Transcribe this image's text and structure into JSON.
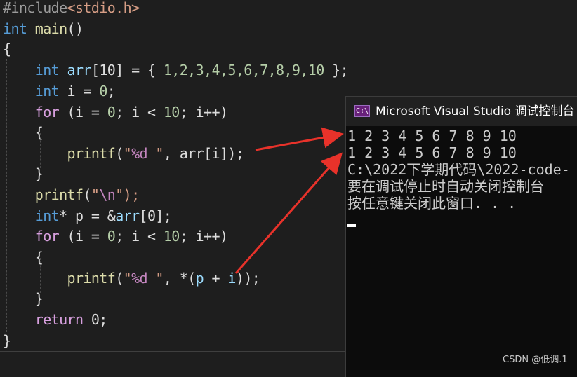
{
  "editor": {
    "include_directive": "#include",
    "include_header": "<stdio.h>",
    "kw_int": "int",
    "kw_for": "for",
    "kw_return": "return",
    "main_name": "main",
    "main_parens": "()",
    "brace_open": "{",
    "brace_close": "}",
    "arr_decl_name": "arr",
    "arr_decl_size": "[10] = { ",
    "arr_values": "1,2,3,4,5,6,7,8,9,10",
    "arr_decl_end": " };",
    "i_decl": " i = ",
    "zero": "0",
    "semicolon": ";",
    "for_head_1": " (i = ",
    "for_head_2": "; i < ",
    "ten": "10",
    "for_head_3": "; i++)",
    "printf": "printf",
    "paren_open": "(",
    "fmt_d_quote": "\"",
    "fmt_d": "%d",
    "fmt_d_tail": " \"",
    "arg_arr_i": ", arr[i]);",
    "newline_quote_open": "\"",
    "newline_escape": "\\n",
    "newline_tail": "\");",
    "p_decl": "* p = &",
    "p_decl_tail": "[0];",
    "deref_open": ", *(",
    "deref_p": "p",
    "deref_plus": " + ",
    "deref_i": "i",
    "deref_close": "));",
    "return_tail": " 0;"
  },
  "console": {
    "title": "Microsoft Visual Studio 调试控制台",
    "icon_text": "C:\\",
    "output_lines": [
      "1 2 3 4 5 6 7 8 9 10",
      "1 2 3 4 5 6 7 8 9 10",
      "C:\\2022下学期代码\\2022-code-",
      "要在调试停止时自动关闭控制台",
      "按任意键关闭此窗口. . ."
    ]
  },
  "watermark": "CSDN @低调.1",
  "colors": {
    "editor_bg": "#1e1e1e",
    "keyword": "#569cd6",
    "control": "#d8a0df",
    "string": "#d69d85",
    "number": "#b5cea8",
    "variable": "#9cdcfe",
    "function": "#dcdcaa",
    "console_bg": "#0c0c0c",
    "console_title_bg": "#202020",
    "arrow": "#e8322a"
  },
  "icons": [
    "console-app-icon"
  ]
}
